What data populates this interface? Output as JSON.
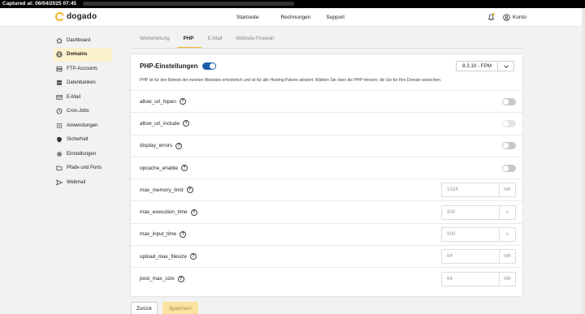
{
  "capture": {
    "label": "Captured at: 06/04/2025 07:45"
  },
  "app": {
    "logo_text": "dogado"
  },
  "topnav": {
    "links": [
      "Startseite",
      "Rechnungen",
      "Support"
    ],
    "account_label": "Konto"
  },
  "sidebar": {
    "items": [
      {
        "label": "Dashboard",
        "icon": "home-icon"
      },
      {
        "label": "Domains",
        "icon": "globe-icon",
        "active": true
      },
      {
        "label": "FTP-Accounts",
        "icon": "server-icon"
      },
      {
        "label": "Datenbanken",
        "icon": "database-icon"
      },
      {
        "label": "E-Mail",
        "icon": "mail-icon"
      },
      {
        "label": "Cron-Jobs",
        "icon": "clock-icon"
      },
      {
        "label": "Anwendungen",
        "icon": "grid-icon"
      },
      {
        "label": "Sicherheit",
        "icon": "shield-icon"
      },
      {
        "label": "Einstellungen",
        "icon": "gear-icon"
      },
      {
        "label": "Pfade und Ports",
        "icon": "folder-icon"
      },
      {
        "label": "Webmail",
        "icon": "send-icon"
      }
    ]
  },
  "tabs": [
    {
      "label": "Weiterleitung"
    },
    {
      "label": "PHP",
      "active": true
    },
    {
      "label": "E-Mail"
    },
    {
      "label": "Website-Firewall"
    }
  ],
  "php": {
    "title": "PHP-Einstellungen",
    "enabled": true,
    "version": "8.3.10 - FPM",
    "description": "PHP ist für den Betrieb der meisten Websites erforderlich und ist für alle Hosting-Pakete aktiviert. Wählen Sie oben die PHP-Version, die Sie für Ihre Domain wünschen.",
    "toggles": [
      {
        "name": "allow_url_fopen",
        "on": false,
        "disabled": false
      },
      {
        "name": "allow_url_include",
        "on": false,
        "disabled": true
      },
      {
        "name": "display_errors",
        "on": false,
        "disabled": false
      },
      {
        "name": "opcache_enable",
        "on": false,
        "disabled": false
      }
    ],
    "fields": [
      {
        "name": "max_memory_limit",
        "value": "1024",
        "unit": "MB"
      },
      {
        "name": "max_execution_time",
        "value": "900",
        "unit": "s"
      },
      {
        "name": "max_input_time",
        "value": "900",
        "unit": "s"
      },
      {
        "name": "upload_max_filesize",
        "value": "64",
        "unit": "MB"
      },
      {
        "name": "post_max_size",
        "value": "64",
        "unit": "MB"
      }
    ]
  },
  "footer": {
    "back_label": "Zurück",
    "save_label": "Speichern"
  },
  "colors": {
    "accent": "#f0b429",
    "active_bg": "#fbf1cc",
    "switch_on": "#1c5fa8"
  }
}
